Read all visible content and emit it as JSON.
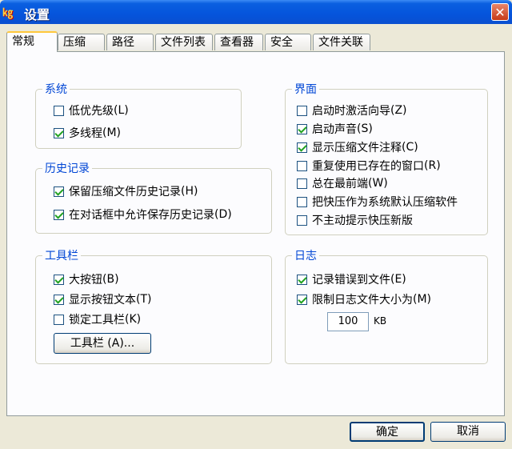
{
  "window": {
    "title": "设置",
    "app_icon_text": "㎏",
    "close_symbol": "✕"
  },
  "tabs": [
    "常规",
    "压缩",
    "路径",
    "文件列表",
    "查看器",
    "安全",
    "文件关联"
  ],
  "groups": {
    "system": {
      "title": "系统",
      "items": [
        {
          "label": "低优先级",
          "hotkey": "(L)",
          "checked": false
        },
        {
          "label": "多线程",
          "hotkey": "(M)",
          "checked": true
        }
      ]
    },
    "history": {
      "title": "历史记录",
      "items": [
        {
          "label": "保留压缩文件历史记录",
          "hotkey": "(H)",
          "checked": true
        },
        {
          "label": "在对话框中允许保存历史记录",
          "hotkey": "(D)",
          "checked": true
        }
      ]
    },
    "toolbar": {
      "title": "工具栏",
      "items": [
        {
          "label": "大按钮",
          "hotkey": "(B)",
          "checked": true
        },
        {
          "label": "显示按钮文本",
          "hotkey": "(T)",
          "checked": true
        },
        {
          "label": "锁定工具栏",
          "hotkey": "(K)",
          "checked": false
        }
      ],
      "button_label": "工具栏 (A)..."
    },
    "interface": {
      "title": "界面",
      "items": [
        {
          "label": "启动时激活向导",
          "hotkey": "(Z)",
          "checked": false
        },
        {
          "label": "启动声音",
          "hotkey": "(S)",
          "checked": true
        },
        {
          "label": "显示压缩文件注释",
          "hotkey": "(C)",
          "checked": true
        },
        {
          "label": "重复使用已存在的窗口",
          "hotkey": "(R)",
          "checked": false
        },
        {
          "label": "总在最前端",
          "hotkey": "(W)",
          "checked": false
        },
        {
          "label": "把快压作为系统默认压缩软件",
          "hotkey": "",
          "checked": false
        },
        {
          "label": "不主动提示快压新版",
          "hotkey": "",
          "checked": false
        }
      ]
    },
    "log": {
      "title": "日志",
      "items": [
        {
          "label": "记录错误到文件",
          "hotkey": "(E)",
          "checked": true
        },
        {
          "label": "限制日志文件大小为",
          "hotkey": "(M)",
          "checked": true
        }
      ],
      "size_value": "100",
      "size_unit": "KB"
    }
  },
  "footer": {
    "ok_label": "确定",
    "cancel_label": "取消"
  }
}
